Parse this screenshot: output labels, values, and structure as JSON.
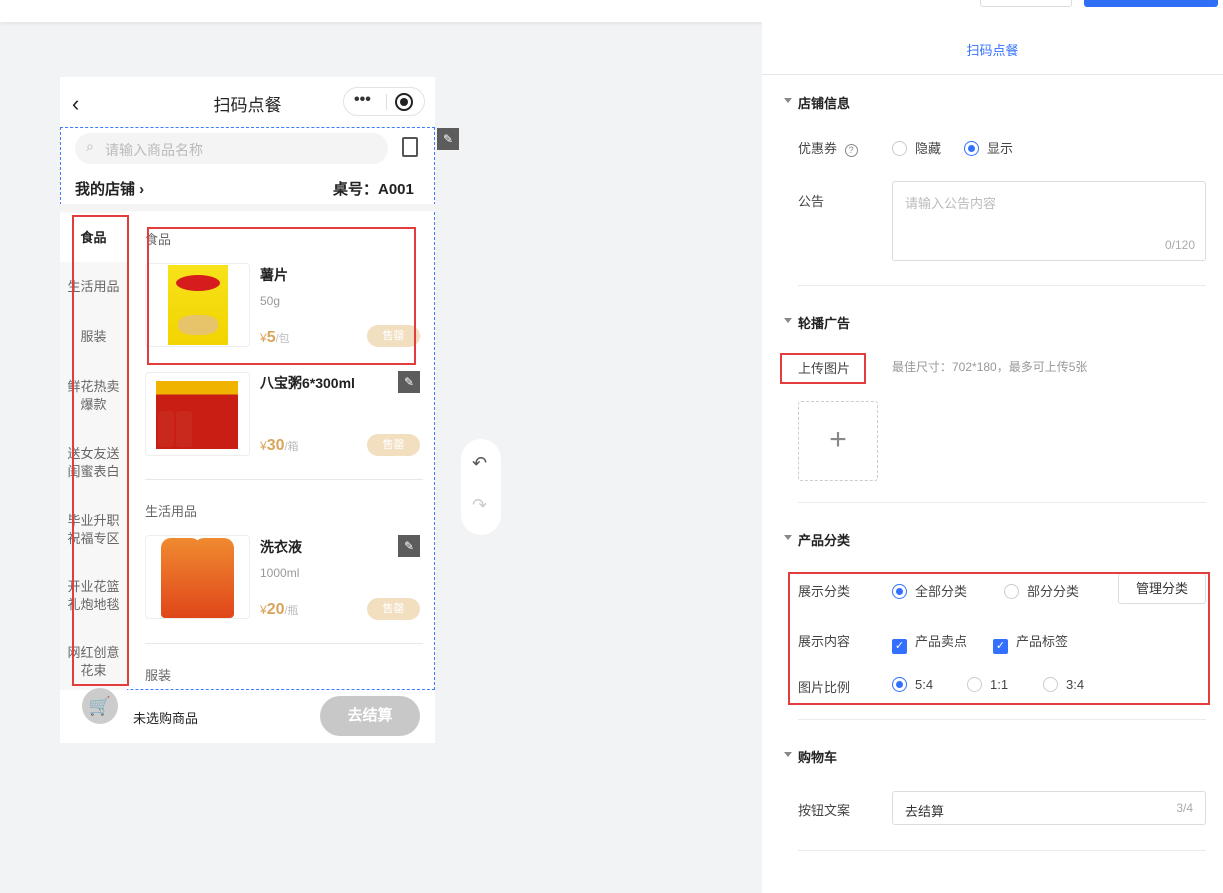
{
  "phone": {
    "title": "扫码点餐",
    "search_placeholder": "请输入商品名称",
    "store": "我的店铺",
    "table": "桌号：A001",
    "categories": [
      "食品",
      "生活用品",
      "服装",
      "鲜花热卖爆款",
      "送女友送闺蜜表白",
      "毕业升职祝福专区",
      "开业花篮礼炮地毯",
      "网红创意花束"
    ],
    "sections": [
      {
        "title": "食品"
      },
      {
        "title": "生活用品"
      },
      {
        "title": "服装"
      }
    ],
    "products": [
      {
        "name": "薯片",
        "spec": "50g",
        "currency": "¥",
        "price": "5",
        "unit": "/包",
        "status": "售罄"
      },
      {
        "name": "八宝粥6*300ml",
        "spec": "",
        "currency": "¥",
        "price": "30",
        "unit": "/箱",
        "status": "售罄"
      },
      {
        "name": "洗衣液",
        "spec": "1000ml",
        "currency": "¥",
        "price": "20",
        "unit": "/瓶",
        "status": "售罄"
      }
    ],
    "cart_text": "未选购商品",
    "checkout": "去结算"
  },
  "panel": {
    "title": "扫码点餐",
    "store_info": {
      "title": "店铺信息",
      "coupon_label": "优惠券",
      "coupon_options": [
        "隐藏",
        "显示"
      ],
      "coupon_selected": "显示",
      "notice_label": "公告",
      "notice_placeholder": "请输入公告内容",
      "notice_count": "0/120"
    },
    "banner": {
      "title": "轮播广告",
      "upload_label": "上传图片",
      "hint": "最佳尺寸：702*180，最多可上传5张"
    },
    "category": {
      "title": "产品分类",
      "display_label": "展示分类",
      "display_options": [
        "全部分类",
        "部分分类"
      ],
      "manage": "管理分类",
      "content_label": "展示内容",
      "content_options": [
        "产品卖点",
        "产品标签"
      ],
      "ratio_label": "图片比例",
      "ratio_options": [
        "5:4",
        "1:1",
        "3:4"
      ]
    },
    "cart": {
      "title": "购物车",
      "button_label": "按钮文案",
      "button_value": "去结算",
      "button_count": "3/4"
    }
  },
  "colors": {
    "accent": "#3370ff",
    "price": "#d9a45b",
    "highlight": "#e33c3c"
  }
}
